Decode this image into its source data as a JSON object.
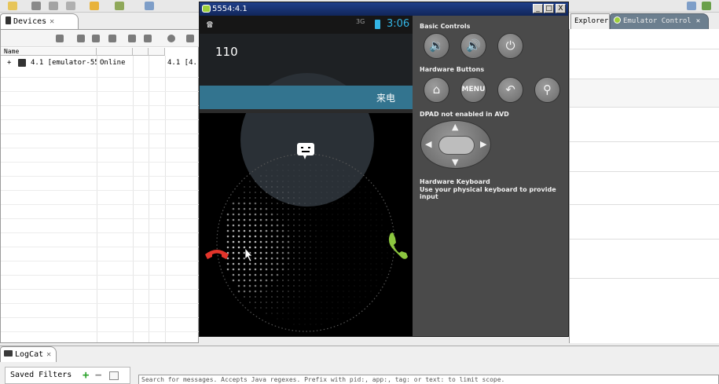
{
  "eclipse": {
    "devices_tab": "Devices",
    "devices_columns": [
      "Name",
      "",
      "",
      ""
    ],
    "device_row": {
      "expander": "+",
      "name": "4.1 [emulator-55!",
      "status": "Online",
      "target": "4.1 [4."
    },
    "explorer_tab": "Explorer",
    "emulator_control_tab": "Emulator Control",
    "logcat_tab": "LogCat",
    "saved_filters_label": "Saved Filters",
    "logcat_search_placeholder": "Search for messages. Accepts Java regexes. Prefix with pid:, app:, tag: or text: to limit scope."
  },
  "emulator": {
    "window_title": "5554:4.1",
    "window_buttons": [
      "_",
      "□",
      "X"
    ],
    "status_bar": {
      "network": "3G",
      "time": "3:06"
    },
    "caller_number": "110",
    "incoming_label": "来电",
    "controls": {
      "basic_controls_label": "Basic Controls",
      "hardware_buttons_label": "Hardware Buttons",
      "dpad_label": "DPAD not enabled in AVD",
      "keyboard_title": "Hardware Keyboard",
      "keyboard_hint": "Use your physical keyboard to provide input",
      "menu_label": "MENU"
    }
  },
  "colors": {
    "accent_blue": "#33b5e5",
    "incoming_band": "#33748f",
    "answer_green": "#8cc63f",
    "decline_red": "#e2352b"
  }
}
